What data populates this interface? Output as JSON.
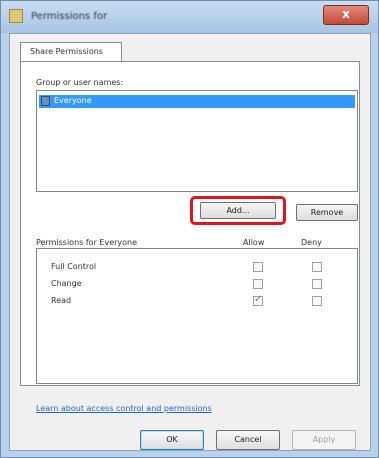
{
  "window": {
    "title": "Permissions for",
    "close_label": "x"
  },
  "tabs": [
    {
      "label": "Share Permissions"
    }
  ],
  "groups": {
    "label": "Group or user names:",
    "items": [
      {
        "label": "Everyone",
        "selected": true
      }
    ],
    "add_label": "Add...",
    "remove_label": "Remove"
  },
  "permissions": {
    "header": "Permissions for Everyone",
    "allow_header": "Allow",
    "deny_header": "Deny",
    "rows": [
      {
        "label": "Full Control",
        "allow": false,
        "deny": false
      },
      {
        "label": "Change",
        "allow": false,
        "deny": false
      },
      {
        "label": "Read",
        "allow": true,
        "deny": false
      }
    ]
  },
  "help_link": "Learn about access control and permissions",
  "footer": {
    "ok_label": "OK",
    "cancel_label": "Cancel",
    "apply_label": "Apply"
  },
  "colors": {
    "highlight": "#e0141e",
    "selection": "#3399ff"
  }
}
